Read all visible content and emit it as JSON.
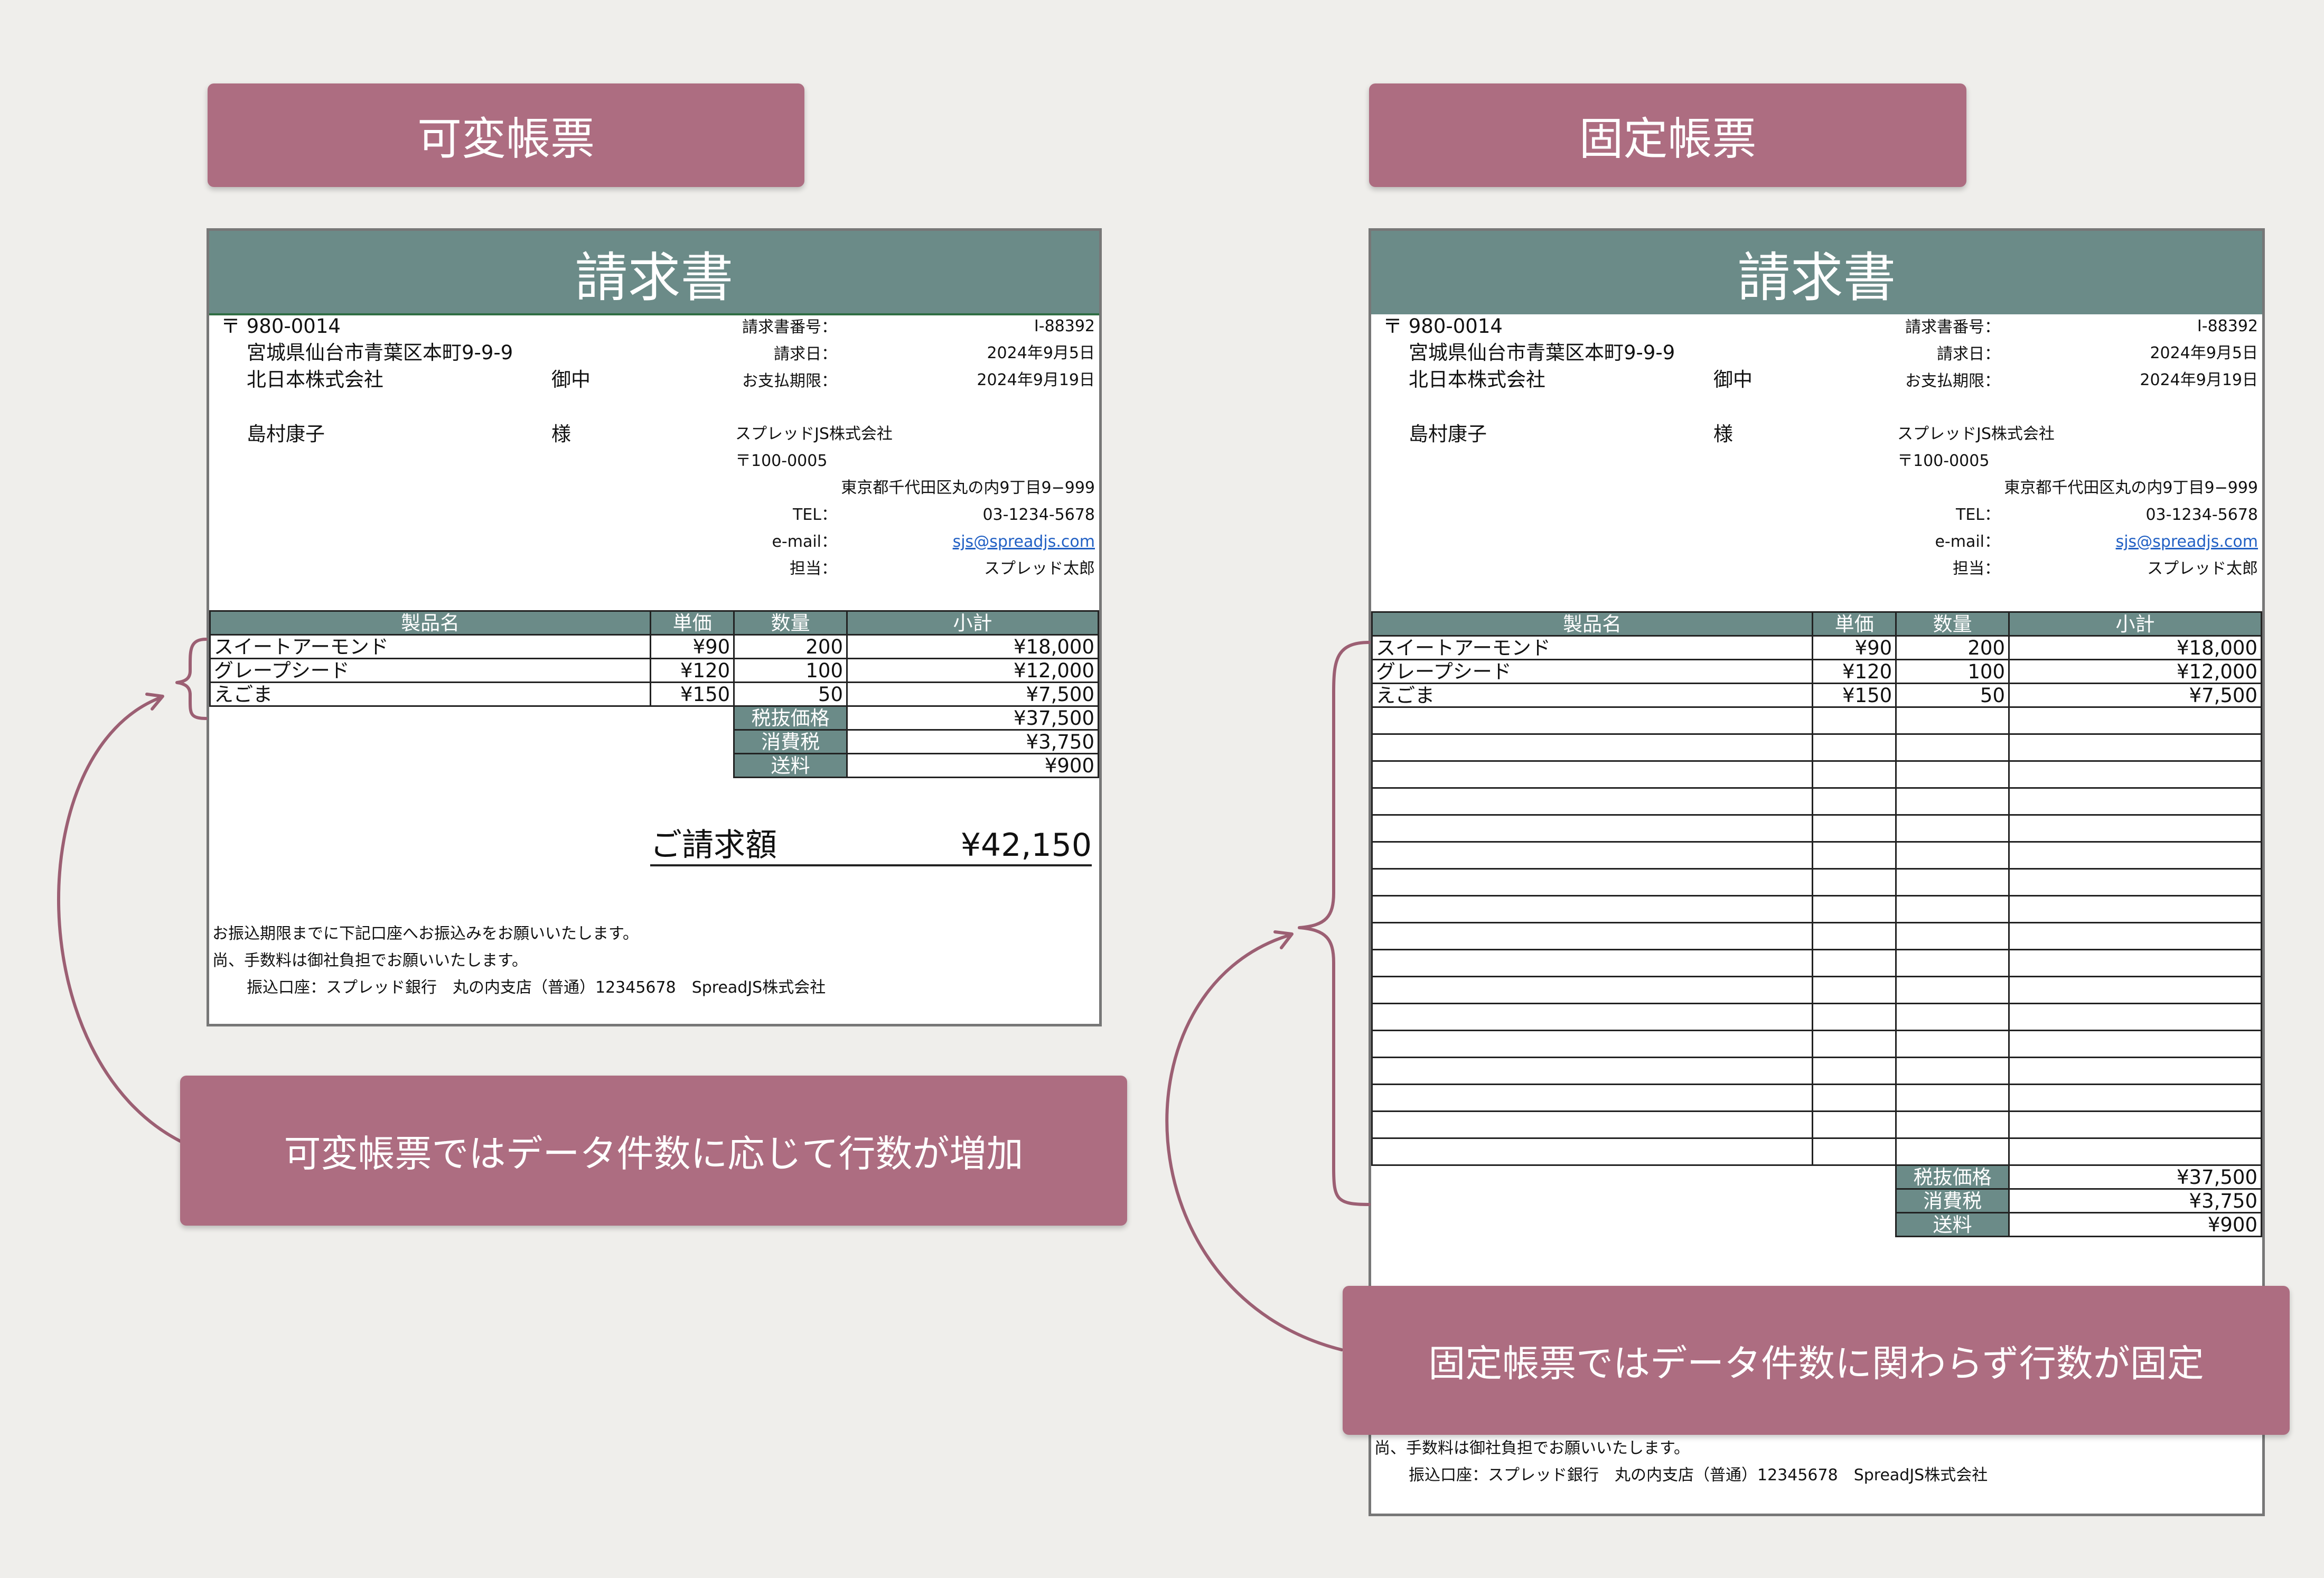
{
  "labels": {
    "variable_title": "可変帳票",
    "fixed_title": "固定帳票",
    "variable_note": "可変帳票ではデータ件数に応じて行数が増加",
    "fixed_note": "固定帳票ではデータ件数に関わらず行数が固定"
  },
  "invoice": {
    "title": "請求書",
    "postal": "〒 980-0014",
    "address": "宮城県仙台市青葉区本町9-9-9",
    "company": "北日本株式会社",
    "company_suffix": "御中",
    "person": "島村康子",
    "person_suffix": "様",
    "meta": [
      {
        "label": "請求書番号：",
        "value": "I-88392"
      },
      {
        "label": "請求日：",
        "value": "2024年9月5日"
      },
      {
        "label": "お支払期限：",
        "value": "2024年9月19日"
      }
    ],
    "issuer": {
      "name": "スプレッドJS株式会社",
      "postal": "〒100-0005",
      "address": "東京都千代田区丸の内9丁目9−999",
      "tel_label": "TEL：",
      "tel": "03-1234-5678",
      "email_label": "e-mail：",
      "email": "sjs@spreadjs.com",
      "staff_label": "担当：",
      "staff": "スプレッド太郎"
    },
    "columns": [
      "製品名",
      "単価",
      "数量",
      "小計"
    ],
    "items": [
      {
        "name": "スイートアーモンド",
        "price": "¥90",
        "qty": "200",
        "subtotal": "¥18,000"
      },
      {
        "name": "グレープシード",
        "price": "¥120",
        "qty": "100",
        "subtotal": "¥12,000"
      },
      {
        "name": "えごま",
        "price": "¥150",
        "qty": "50",
        "subtotal": "¥7,500"
      }
    ],
    "totals": [
      {
        "label": "税抜価格",
        "value": "¥37,500"
      },
      {
        "label": "消費税",
        "value": "¥3,750"
      },
      {
        "label": "送料",
        "value": "¥900"
      }
    ],
    "grand_label": "ご請求額",
    "grand_value": "¥42,150",
    "footer": [
      "お振込期限までに下記口座へお振込みをお願いいたします。",
      "尚、手数料は御社負担でお願いいたします。",
      "振込口座：スプレッド銀行　丸の内支店（普通）12345678　SpreadJS株式会社"
    ]
  },
  "colors": {
    "background": "#efeeeb",
    "label_box": "#ad6d81",
    "header_green": "#6b8b88"
  }
}
